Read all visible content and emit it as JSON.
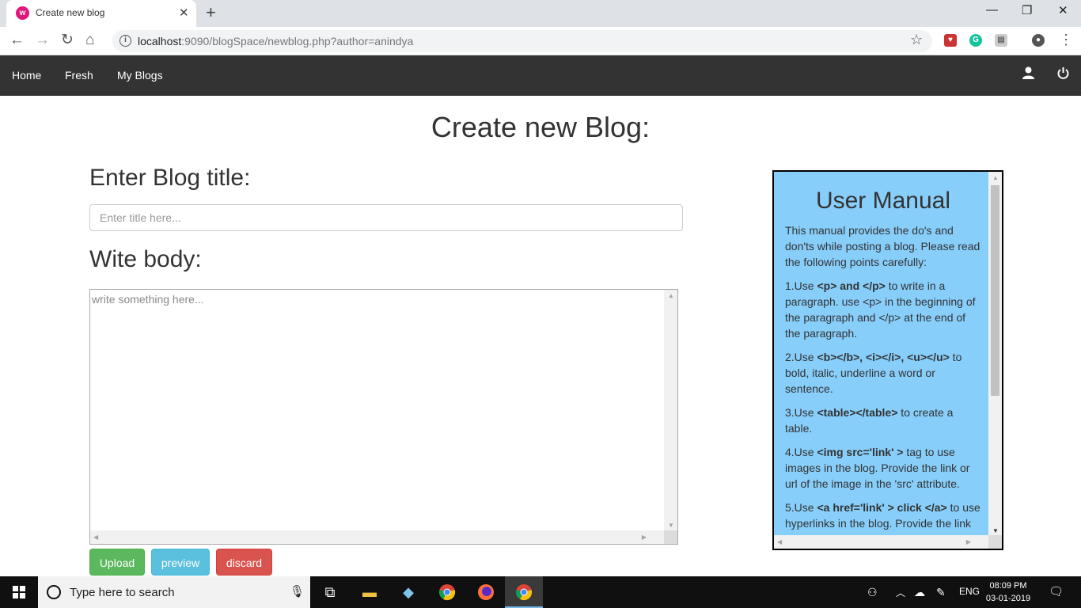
{
  "browser": {
    "tab_title": "Create new blog",
    "url_host": "localhost",
    "url_rest": ":9090/blogSpace/newblog.php?author=anindya"
  },
  "nav": {
    "links": [
      "Home",
      "Fresh",
      "My Blogs"
    ]
  },
  "page": {
    "title": "Create new Blog:",
    "title_label": "Enter Blog title:",
    "title_placeholder": "Enter title here...",
    "body_label": "Wite body:",
    "body_placeholder": "write something here...",
    "buttons": {
      "upload": "Upload",
      "preview": "preview",
      "discard": "discard"
    }
  },
  "manual": {
    "title": "User Manual",
    "intro": "This manual provides the do's and don'ts while posting a blog. Please read the following points carefully:",
    "items": [
      {
        "num": "1.Use ",
        "code": "<p> and </p>",
        "text": " to write in a paragraph. use <p> in the beginning of the paragraph and </p> at the end of the paragraph."
      },
      {
        "num": "2.Use ",
        "code": "<b></b>, <i></i>, <u></u>",
        "text": " to bold, italic, underline a word or sentence."
      },
      {
        "num": "3.Use ",
        "code": "<table></table>",
        "text": " to create a table."
      },
      {
        "num": "4.Use ",
        "code": "<img src='link' >",
        "text": " tag to use images in the blog. Provide the link or url of the image in the 'src' attribute."
      },
      {
        "num": "5.Use ",
        "code": "<a href='link' > click </a>",
        "text": " to use hyperlinks in the blog. Provide the link or url of the page in the 'href' attribute."
      }
    ]
  },
  "taskbar": {
    "search_placeholder": "Type here to search",
    "language": "ENG",
    "time": "08:09 PM",
    "date": "03-01-2019"
  },
  "colors": {
    "navbar": "#333333",
    "manual_bg": "#87cefa",
    "upload": "#5cb85c",
    "preview": "#5bc0de",
    "discard": "#d9534f"
  }
}
